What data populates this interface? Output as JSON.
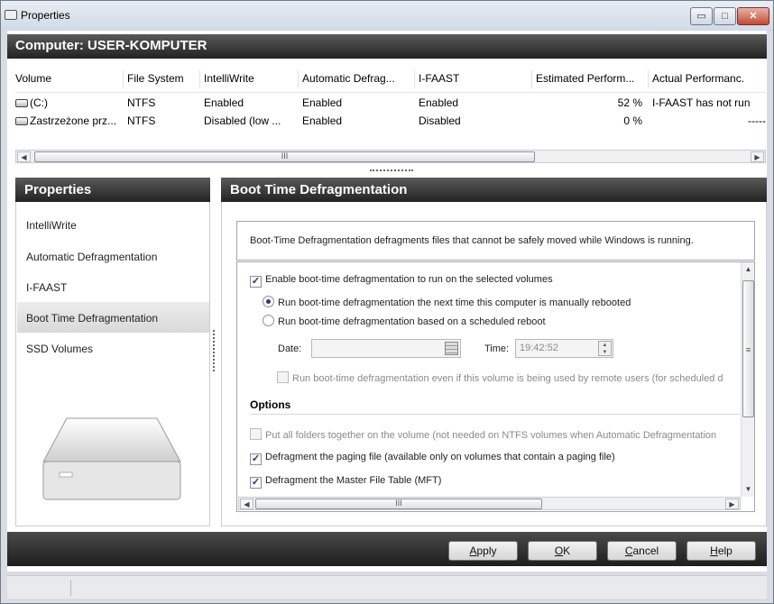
{
  "window": {
    "title": "Properties",
    "min_glyph": "▭",
    "max_glyph": "□",
    "close_glyph": "✕"
  },
  "computer": {
    "header": "Computer: USER-KOMPUTER"
  },
  "volumes": {
    "columns": [
      "Volume",
      "File System",
      "IntelliWrite",
      "Automatic Defrag...",
      "I-FAAST",
      "Estimated Perform...",
      "Actual Performanc."
    ],
    "rows": [
      {
        "volume": "(C:)",
        "fs": "NTFS",
        "intelliwrite": "Enabled",
        "autodefrag": "Enabled",
        "ifaast": "Enabled",
        "est": "52 %",
        "actual": "I-FAAST has not run"
      },
      {
        "volume": "Zastrzeżone prz...",
        "fs": "NTFS",
        "intelliwrite": "Disabled (low ...",
        "autodefrag": "Enabled",
        "ifaast": "Disabled",
        "est": "0 %",
        "actual": "-----"
      }
    ],
    "scroll_grip": "III"
  },
  "properties": {
    "header": "Properties",
    "items": [
      "IntelliWrite",
      "Automatic Defragmentation",
      "I-FAAST",
      "Boot Time Defragmentation",
      "SSD Volumes"
    ],
    "selected_index": 3
  },
  "boot_time": {
    "header": "Boot Time Defragmentation",
    "description": "Boot-Time Defragmentation defragments files that cannot be safely moved while Windows is running.",
    "enable_label": "Enable boot-time defragmentation to run on the selected volumes",
    "enable_checked": true,
    "radio_manual": "Run boot-time defragmentation the next time this computer is manually rebooted",
    "radio_scheduled": "Run boot-time defragmentation based on a scheduled reboot",
    "selected_radio": "manual",
    "date_label": "Date:",
    "date_value": "",
    "time_label": "Time:",
    "time_value": "19:42:52",
    "remote_label": "Run boot-time defragmentation even if this volume is being used by remote users (for scheduled d",
    "remote_checked": false,
    "options_title": "Options",
    "opt_folders": "Put all folders together on the volume (not needed on NTFS volumes when Automatic Defragmentation",
    "opt_folders_checked": false,
    "opt_paging": "Defragment the paging file (available only on volumes that contain a paging file)",
    "opt_paging_checked": true,
    "opt_mft": "Defragment the Master File Table (MFT)",
    "opt_mft_checked": true,
    "scroll_grip": "III",
    "vscroll_grip": "≡"
  },
  "buttons": {
    "apply_u": "A",
    "apply_rest": "pply",
    "ok_u": "O",
    "ok_rest": "K",
    "cancel_u": "C",
    "cancel_rest": "ancel",
    "help_u": "H",
    "help_rest": "elp"
  },
  "colors": {
    "header_dark": "#222222",
    "selected_nav": "#dcdcdc",
    "close_red": "#c44a34"
  },
  "icons": {
    "window": "disk-drive-icon",
    "volume": "disk-drive-icon",
    "calendar": "calendar-icon"
  }
}
